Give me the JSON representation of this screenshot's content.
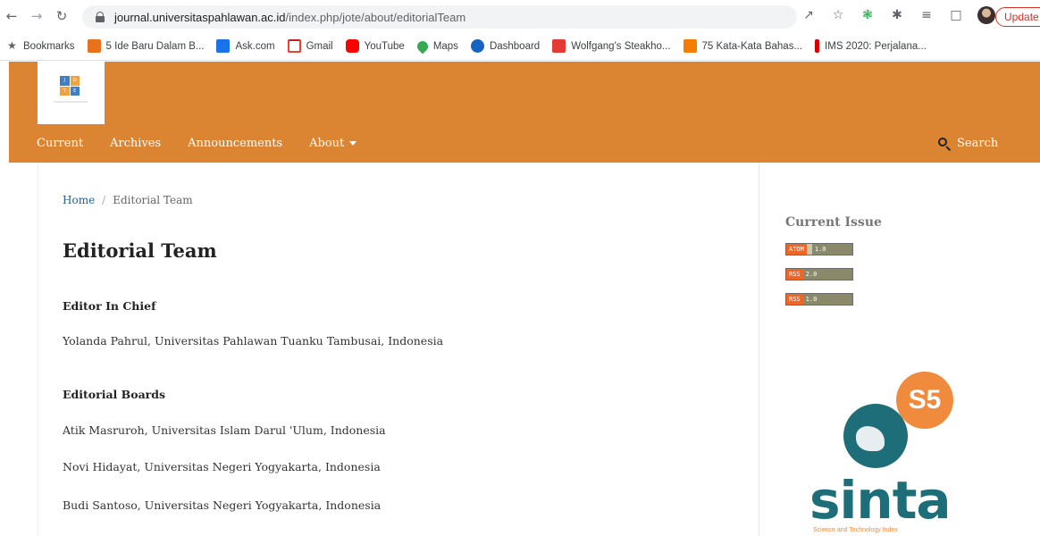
{
  "browser": {
    "url_host": "journal.universitaspahlawan.ac.id",
    "url_path": "/index.php/jote/about/editorialTeam",
    "update_label": "Update",
    "bookmarks": [
      {
        "label": "Bookmarks",
        "icon": "star-icon"
      },
      {
        "label": "5 Ide Baru Dalam B...",
        "icon": "blog-icon"
      },
      {
        "label": "Ask.com",
        "icon": "ask-icon"
      },
      {
        "label": "Gmail",
        "icon": "gmail-icon"
      },
      {
        "label": "YouTube",
        "icon": "youtube-icon"
      },
      {
        "label": "Maps",
        "icon": "maps-icon"
      },
      {
        "label": "Dashboard",
        "icon": "dashboard-icon"
      },
      {
        "label": "Wolfgang's Steakho...",
        "icon": "wolfgang-icon"
      },
      {
        "label": "75 Kata-Kata Bahas...",
        "icon": "kata-icon"
      },
      {
        "label": "IMS 2020: Perjalana...",
        "icon": "ims-icon"
      }
    ]
  },
  "header": {
    "accent_color": "#db8431",
    "logo_letters": [
      "J",
      "O",
      "T",
      "E"
    ],
    "nav": {
      "current": "Current",
      "archives": "Archives",
      "announcements": "Announcements",
      "about": "About"
    },
    "search_label": "Search"
  },
  "main": {
    "breadcrumb": {
      "home": "Home",
      "separator": "/",
      "current": "Editorial Team"
    },
    "title": "Editorial Team",
    "editor_in_chief": {
      "heading": "Editor In Chief",
      "members": [
        "Yolanda Pahrul, Universitas Pahlawan Tuanku Tambusai, Indonesia"
      ]
    },
    "editorial_boards": {
      "heading": "Editorial Boards",
      "members": [
        "Atik Masruroh, Universitas Islam Darul 'Ulum, Indonesia",
        "Novi Hidayat, Universitas Negeri Yogyakarta, Indonesia",
        "Budi Santoso, Universitas Negeri Yogyakarta, Indonesia"
      ]
    }
  },
  "sidebar": {
    "title": "Current Issue",
    "feeds": [
      {
        "label": "ATOM",
        "version": "1.0"
      },
      {
        "label": "RSS",
        "version": "2.0"
      },
      {
        "label": "RSS",
        "version": "1.0"
      }
    ],
    "sinta": {
      "badge": "S5",
      "word": "sinta",
      "tagline": "Science and Technology Index"
    }
  }
}
